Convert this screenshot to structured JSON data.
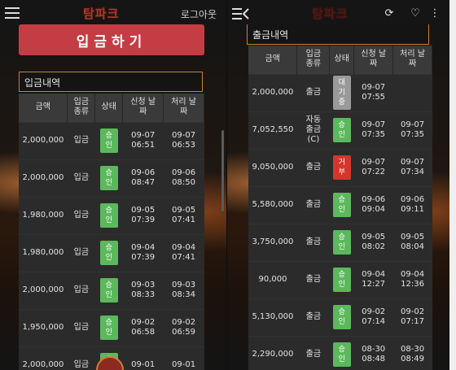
{
  "left": {
    "logo": "탐파크",
    "logout": "로그아웃",
    "deposit_button": "입금하기",
    "panel_title": "입금내역",
    "headers": [
      "금액",
      "입금\n종류",
      "상태",
      "신청 날\n짜",
      "처리 날\n짜"
    ],
    "rows": [
      {
        "amount": "2,000,000",
        "type": "입금",
        "status": "승\n인",
        "req": "09-07\n06:51",
        "proc": "09-07\n06:53"
      },
      {
        "amount": "2,000,000",
        "type": "입금",
        "status": "승\n인",
        "req": "09-06\n08:47",
        "proc": "09-06\n08:50"
      },
      {
        "amount": "1,980,000",
        "type": "입금",
        "status": "승\n인",
        "req": "09-05\n07:39",
        "proc": "09-05\n07:41"
      },
      {
        "amount": "1,980,000",
        "type": "입금",
        "status": "승\n인",
        "req": "09-04\n07:39",
        "proc": "09-04\n07:41"
      },
      {
        "amount": "2,000,000",
        "type": "입금",
        "status": "승\n인",
        "req": "09-03\n08:33",
        "proc": "09-03\n08:34"
      },
      {
        "amount": "1,950,000",
        "type": "입금",
        "status": "승\n인",
        "req": "09-02\n06:58",
        "proc": "09-02\n06:59"
      },
      {
        "amount": "2,000,000",
        "type": "입금",
        "status": "승\n인",
        "req": "09-01\n",
        "proc": "09-01\n"
      }
    ]
  },
  "right": {
    "logo": "탐파크",
    "panel_title": "출금내역",
    "headers": [
      "금액",
      "입금\n종류",
      "상태",
      "신청 날\n짜",
      "처리 날\n짜"
    ],
    "rows": [
      {
        "amount": "2,000,000",
        "type": "출금",
        "status": "대\n기\n중",
        "status_kind": "wait",
        "req": "09-07\n07:55",
        "proc": ""
      },
      {
        "amount": "7,052,550",
        "type": "자동\n출금\n(C)",
        "status": "승\n인",
        "status_kind": "ok",
        "req": "09-07\n07:35",
        "proc": "09-07\n07:35"
      },
      {
        "amount": "9,050,000",
        "type": "출금",
        "status": "거\n부",
        "status_kind": "rej",
        "req": "09-07\n07:22",
        "proc": "09-07\n07:34"
      },
      {
        "amount": "5,580,000",
        "type": "출금",
        "status": "승\n인",
        "status_kind": "ok",
        "req": "09-06\n09:04",
        "proc": "09-06\n09:11"
      },
      {
        "amount": "3,750,000",
        "type": "출금",
        "status": "승\n인",
        "status_kind": "ok",
        "req": "09-05\n08:02",
        "proc": "09-05\n08:04"
      },
      {
        "amount": "90,000",
        "type": "출금",
        "status": "승\n인",
        "status_kind": "ok",
        "req": "09-04\n12:27",
        "proc": "09-04\n12:36"
      },
      {
        "amount": "5,130,000",
        "type": "출금",
        "status": "승\n인",
        "status_kind": "ok",
        "req": "09-02\n07:14",
        "proc": "09-02\n07:17"
      },
      {
        "amount": "2,290,000",
        "type": "출금",
        "status": "승\n인",
        "status_kind": "ok",
        "req": "08-30\n08:48",
        "proc": "08-30\n08:49"
      }
    ]
  }
}
